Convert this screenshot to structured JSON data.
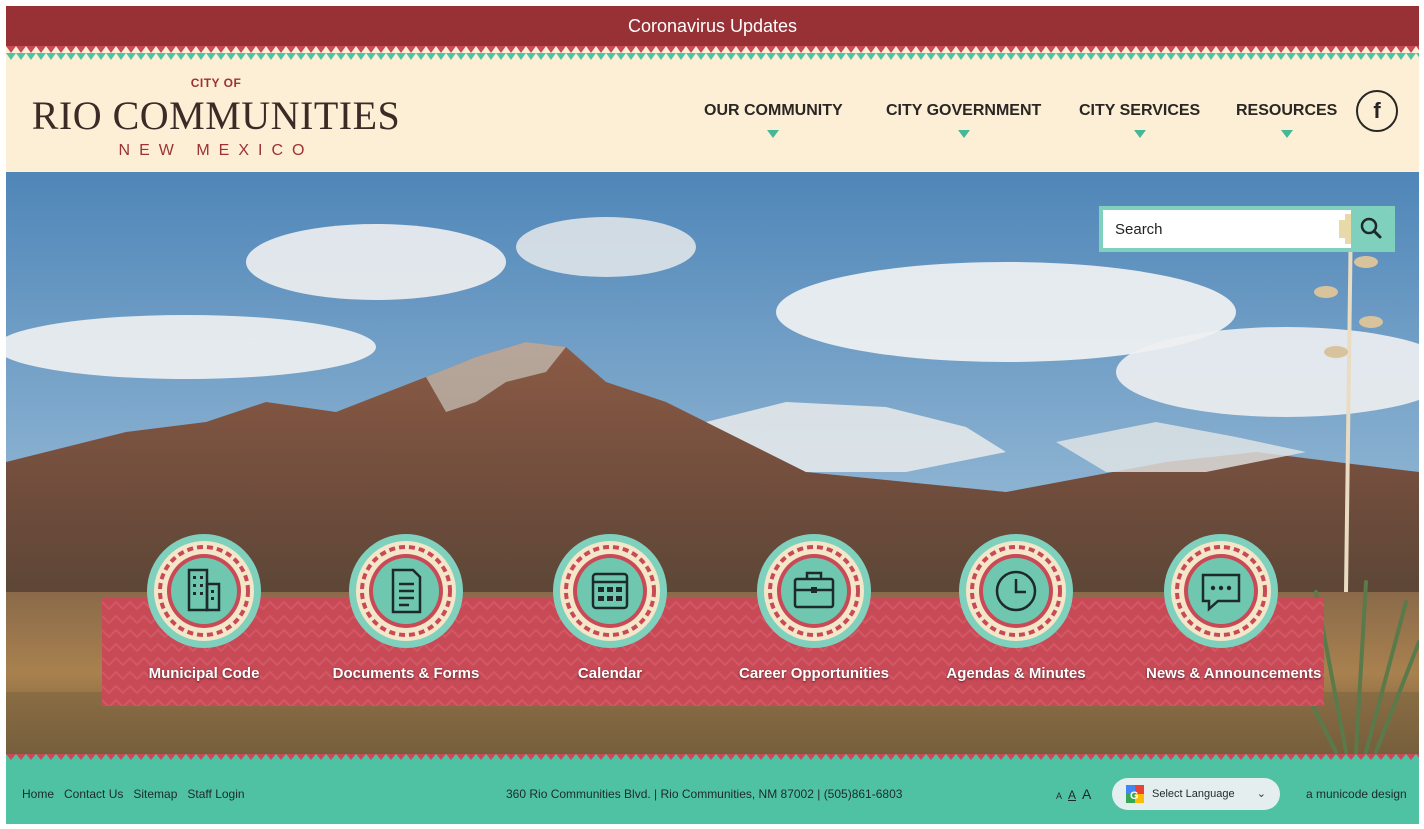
{
  "alert": {
    "label": "Coronavirus Updates"
  },
  "logo": {
    "city_of": "CITY OF",
    "name": "RIO COMMUNITIES",
    "state": "NEW MEXICO"
  },
  "nav": {
    "items": [
      {
        "label": "OUR COMMUNITY"
      },
      {
        "label": "CITY GOVERNMENT"
      },
      {
        "label": "CITY SERVICES"
      },
      {
        "label": "RESOURCES"
      }
    ],
    "social_icon": "facebook-icon",
    "social_glyph": "f"
  },
  "search": {
    "placeholder": "Search",
    "icon": "search-icon"
  },
  "quick_links": [
    {
      "label": "Municipal Code",
      "icon": "building-icon"
    },
    {
      "label": "Documents & Forms",
      "icon": "document-icon"
    },
    {
      "label": "Calendar",
      "icon": "calendar-icon"
    },
    {
      "label": "Career Opportunities",
      "icon": "briefcase-icon"
    },
    {
      "label": "Agendas & Minutes",
      "icon": "clock-icon"
    },
    {
      "label": "News & Announcements",
      "icon": "chat-bubble-icon"
    }
  ],
  "footer": {
    "links": [
      {
        "label": "Home"
      },
      {
        "label": "Contact Us"
      },
      {
        "label": "Sitemap"
      },
      {
        "label": "Staff Login"
      }
    ],
    "address": "360 Rio Communities Blvd. | Rio Communities, NM 87002 | (505)861-6803",
    "font_sizes": [
      "A",
      "A",
      "A"
    ],
    "language_label": "Select Language",
    "credit": "a municode design"
  },
  "colors": {
    "alert_bg": "#973136",
    "header_bg": "#fcefd6",
    "accent_teal": "#50c2a4",
    "accent_red": "#c94a57"
  }
}
